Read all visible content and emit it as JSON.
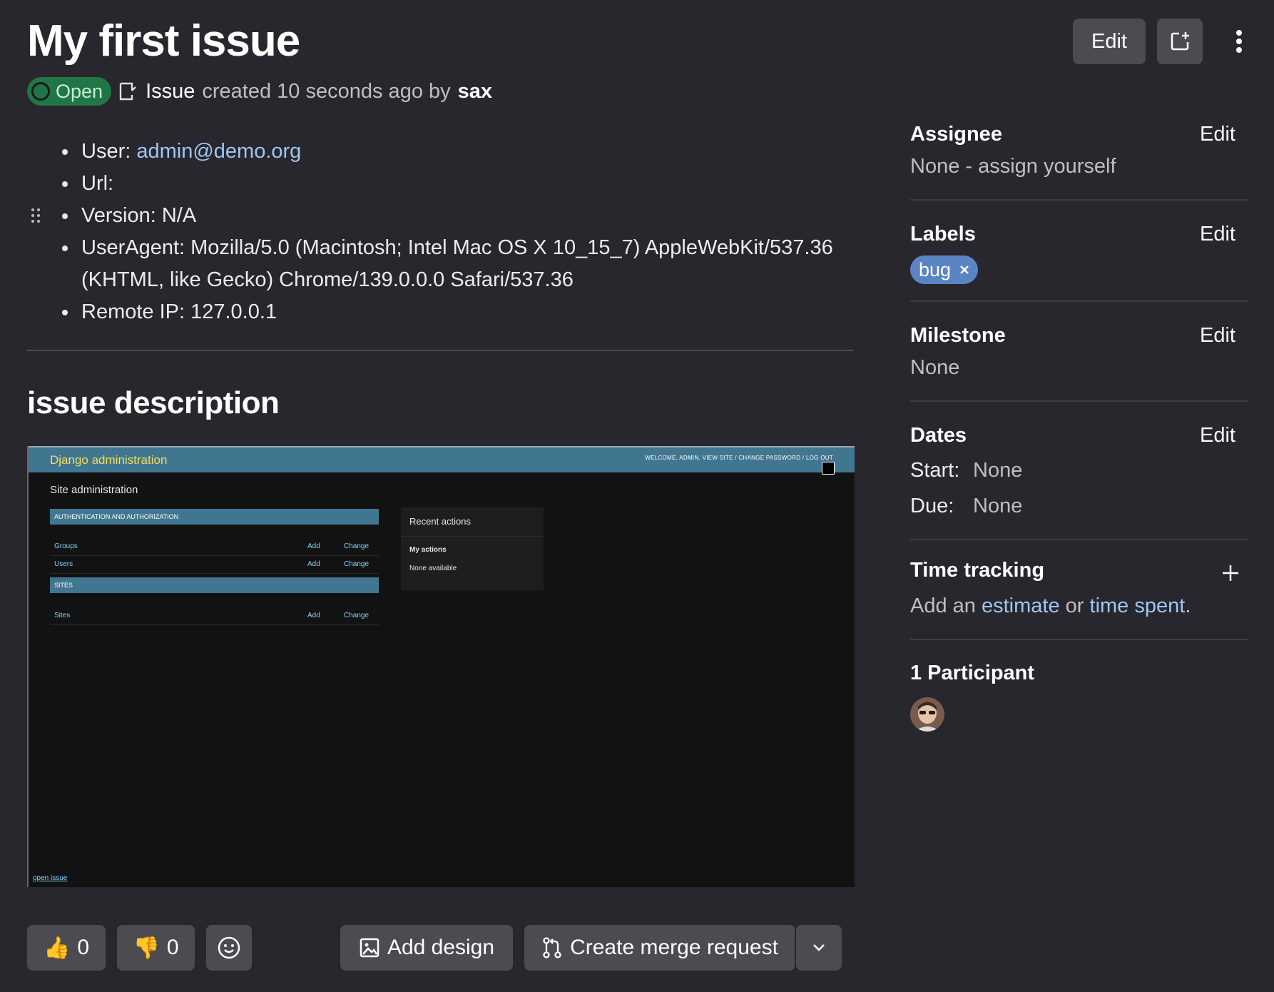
{
  "header": {
    "title": "My first issue",
    "edit_label": "Edit",
    "status": "Open",
    "meta_issue": "Issue",
    "meta_created": "created 10 seconds ago by",
    "author": "sax"
  },
  "details": {
    "user_label": "User:",
    "user_email": "admin@demo.org",
    "url_label": "Url:",
    "version": "Version: N/A",
    "useragent": "UserAgent: Mozilla/5.0 (Macintosh; Intel Mac OS X 10_15_7) AppleWebKit/537.36 (KHTML, like Gecko) Chrome/139.0.0.0 Safari/537.36",
    "remote_ip": "Remote IP: 127.0.0.1"
  },
  "description": {
    "heading": "issue description"
  },
  "screenshot": {
    "brand": "Django administration",
    "user_tools": "WELCOME, ADMIN. VIEW SITE / CHANGE PASSWORD / LOG OUT",
    "site_title": "Site administration",
    "section_auth": "AUTHENTICATION AND AUTHORIZATION",
    "groups": "Groups",
    "users": "Users",
    "section_sites": "SITES",
    "sites": "Sites",
    "add": "Add",
    "change": "Change",
    "recent_title": "Recent actions",
    "my_actions": "My actions",
    "none_available": "None available",
    "footer_link": "open issue"
  },
  "actions": {
    "thumbs_up_count": "0",
    "thumbs_down_count": "0",
    "add_design": "Add design",
    "create_mr": "Create merge request"
  },
  "sidebar": {
    "edit": "Edit",
    "assignee_title": "Assignee",
    "assignee_value": "None - assign yourself",
    "labels_title": "Labels",
    "label_bug": "bug",
    "milestone_title": "Milestone",
    "milestone_value": "None",
    "dates_title": "Dates",
    "start_label": "Start:",
    "start_value": "None",
    "due_label": "Due:",
    "due_value": "None",
    "time_title": "Time tracking",
    "time_add": "Add an",
    "time_estimate": "estimate",
    "time_or": "or",
    "time_spent": "time spent",
    "participants_title": "1 Participant"
  },
  "colors": {
    "background": "#28272d",
    "status_open": "#217645",
    "label_bug": "#5b84c4",
    "link": "#9dc7f1"
  },
  "icons": [
    "new-window-icon",
    "kebab-menu-icon",
    "issue-icon",
    "drag-handle-icon",
    "thumbs-up-icon",
    "thumbs-down-icon",
    "smiley-icon",
    "image-icon",
    "merge-request-icon",
    "chevron-down-icon",
    "close-icon",
    "plus-icon"
  ]
}
